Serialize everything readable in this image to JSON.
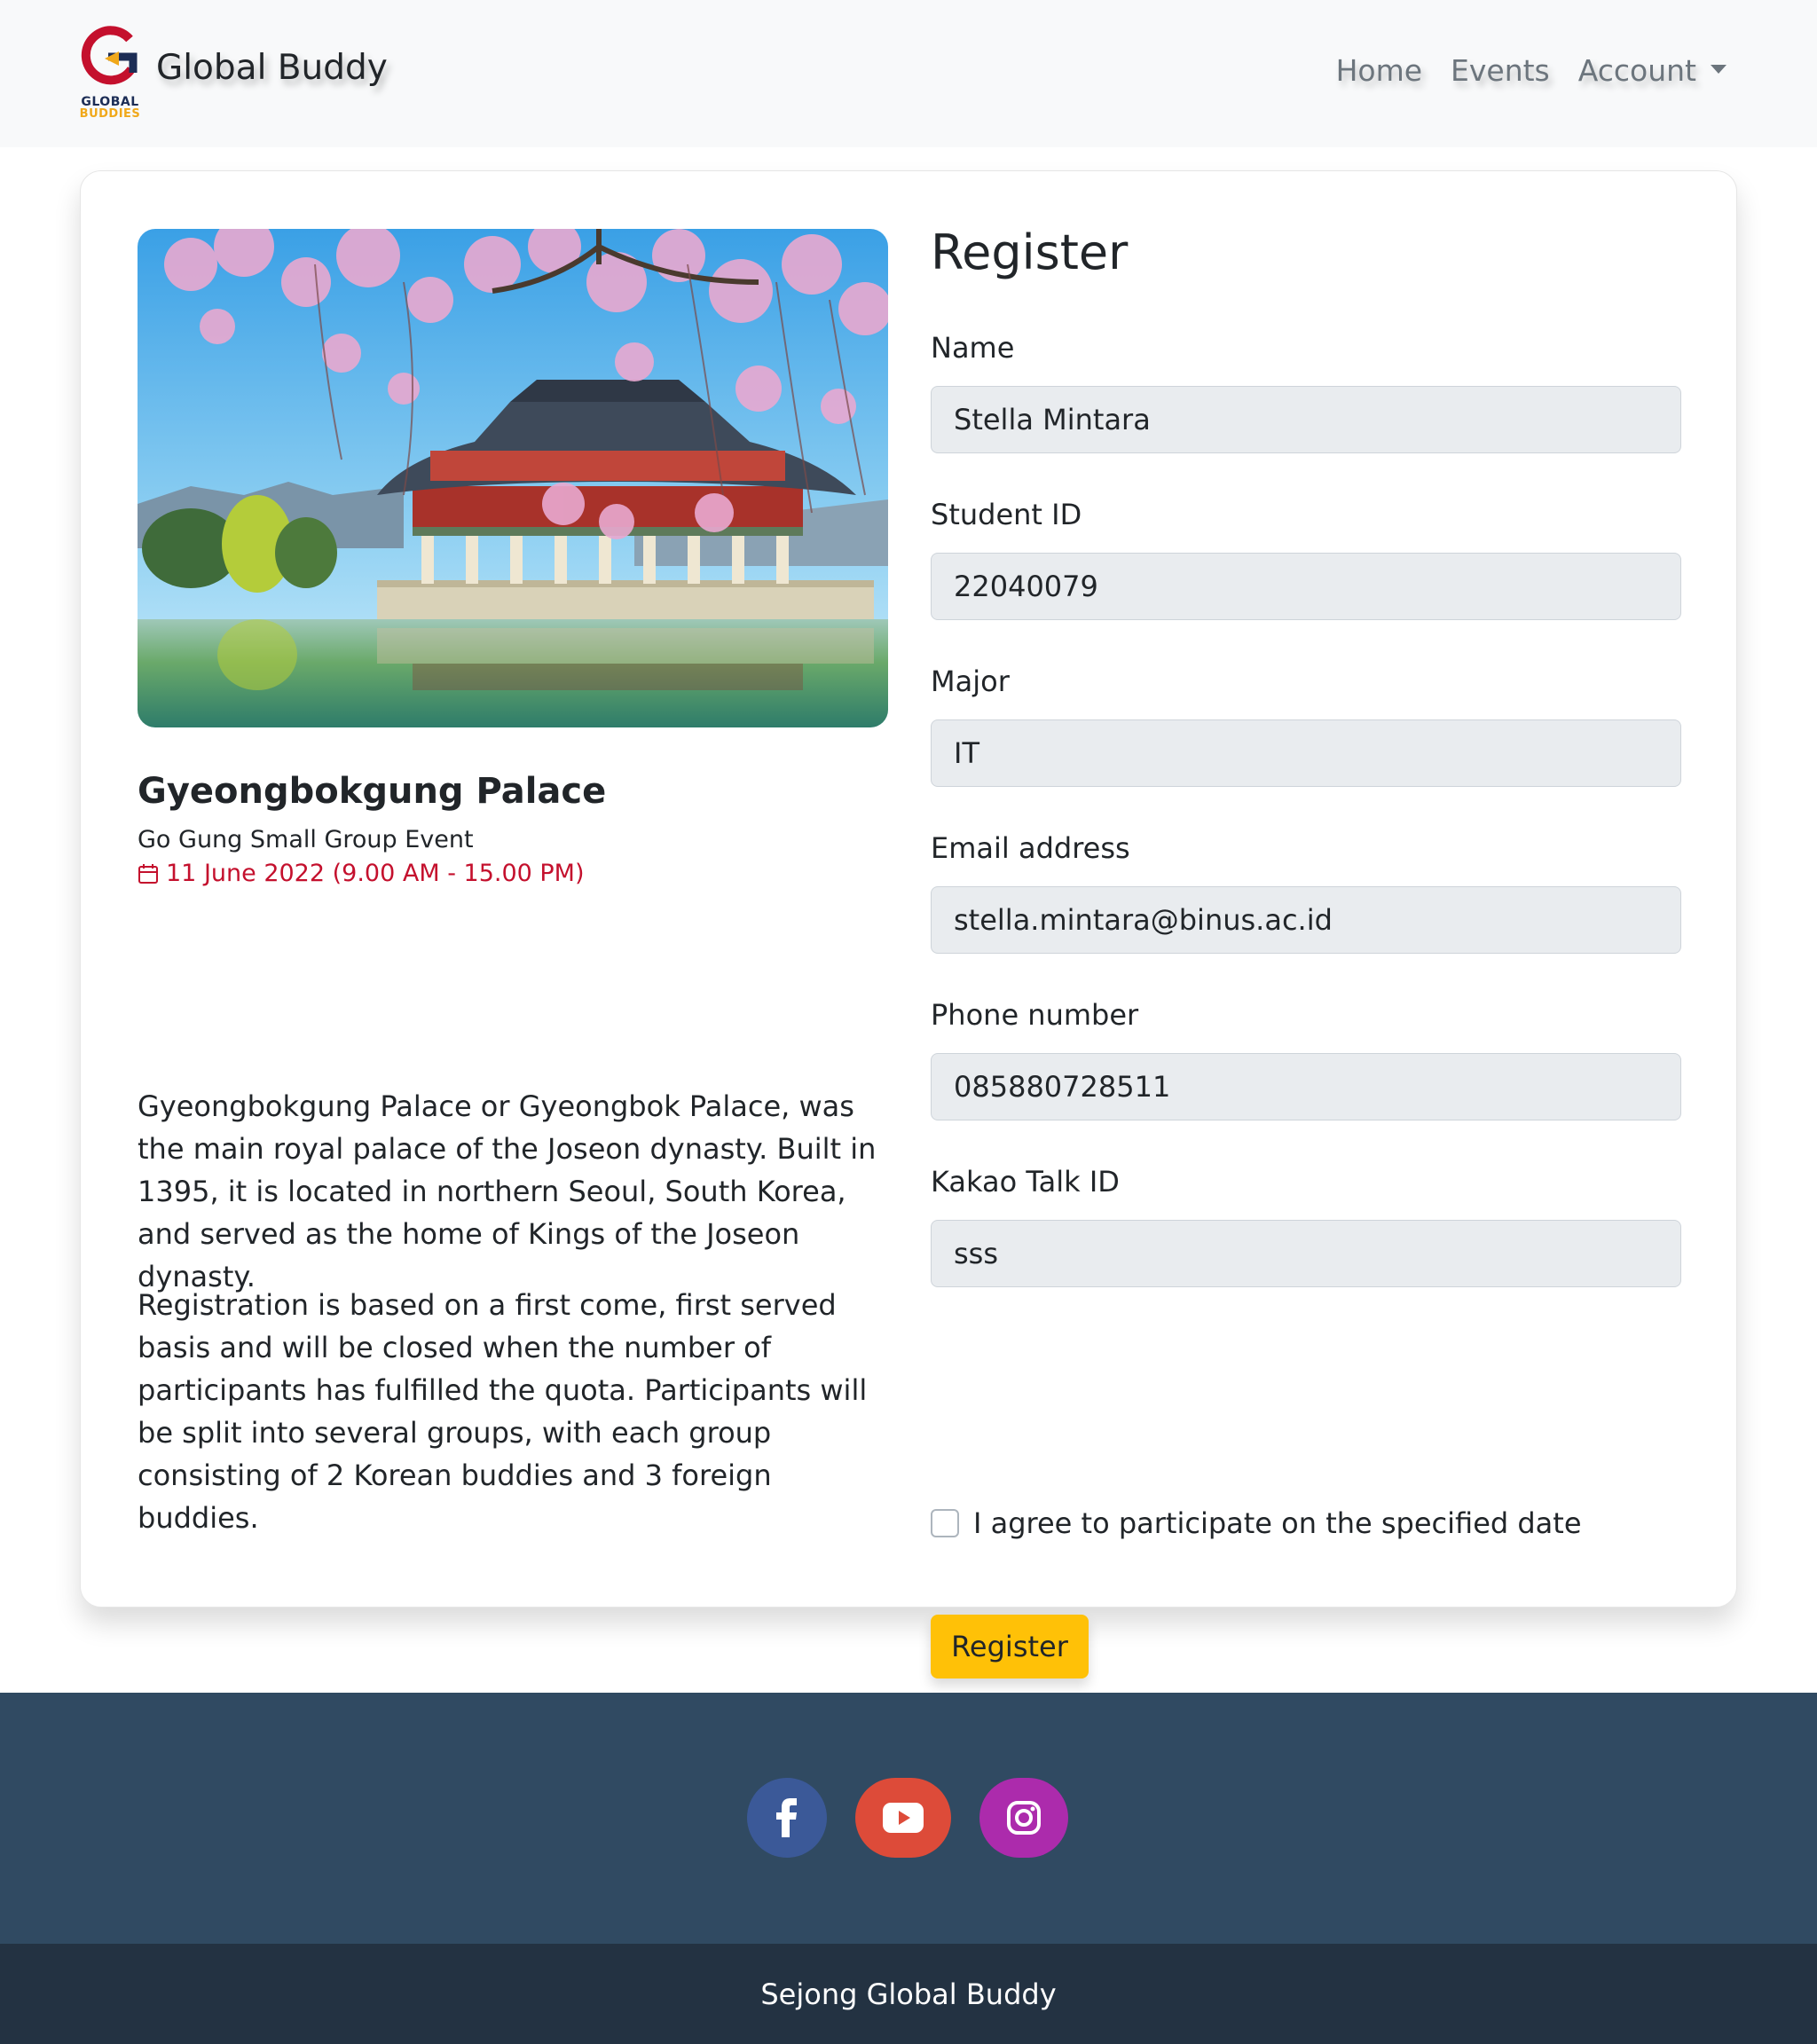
{
  "navbar": {
    "brand": "Global Buddy",
    "logo_line1": "GLOBAL",
    "logo_line2": "BUDDIES",
    "links": {
      "home": "Home",
      "events": "Events",
      "account": "Account"
    }
  },
  "event": {
    "title": "Gyeongbokgung Palace",
    "subtitle": "Go Gung Small Group Event",
    "date": "11 June 2022 (9.00 AM - 15.00 PM)",
    "description1": "Gyeongbokgung Palace or Gyeongbok Palace, was the main royal palace of the Joseon dynasty. Built in 1395, it is located in northern Seoul, South Korea, and served as the home of Kings of the Joseon dynasty.",
    "description2": "Registration is based on a first come, first served basis and will be closed when the number of participants has fulfilled the quota. Participants will be split into several groups, with each group consisting of 2 Korean buddies and 3 foreign buddies."
  },
  "form": {
    "title": "Register",
    "fields": {
      "name": {
        "label": "Name",
        "value": "Stella Mintara"
      },
      "student_id": {
        "label": "Student ID",
        "value": "22040079"
      },
      "major": {
        "label": "Major",
        "value": "IT"
      },
      "email": {
        "label": "Email address",
        "value": "stella.mintara@binus.ac.id"
      },
      "phone": {
        "label": "Phone number",
        "value": "085880728511"
      },
      "kakao": {
        "label": "Kakao Talk ID",
        "value": "sss"
      }
    },
    "agree_label": "I agree to participate on the specified date",
    "agree_checked": false,
    "submit_label": "Register"
  },
  "footer": {
    "social_icons": [
      "facebook-icon",
      "youtube-icon",
      "instagram-icon"
    ],
    "text": "Sejong Global Buddy"
  },
  "colors": {
    "accent": "#ffc107",
    "date": "#c4102d",
    "footer_top": "#304a62",
    "footer_bottom": "#233242"
  }
}
